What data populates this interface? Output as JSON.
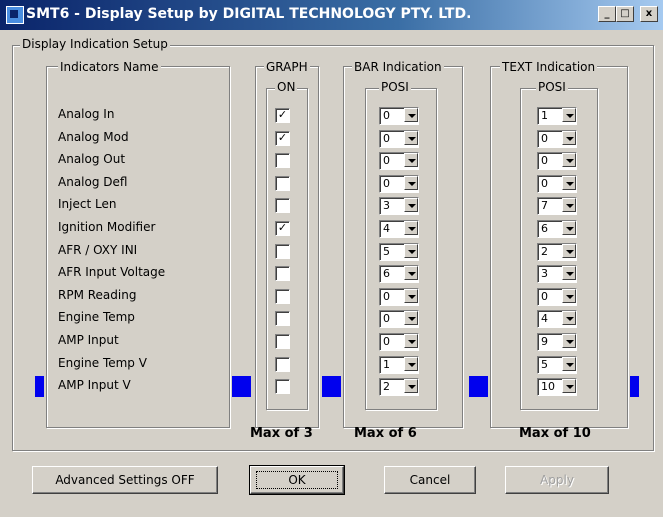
{
  "window": {
    "title": "SMT6 - Display Setup   by DIGITAL TECHNOLOGY PTY. LTD.",
    "minimize": "_",
    "maximize": "□",
    "close": "x"
  },
  "main": {
    "group_label": "Display Indication Setup"
  },
  "indicators": {
    "header": "Indicators Name",
    "items": [
      "Analog In",
      "Analog Mod",
      "Analog Out",
      "Analog Defl",
      "Inject Len",
      "Ignition Modifier",
      "AFR / OXY INI",
      "AFR Input Voltage",
      "RPM Reading",
      "Engine Temp",
      "AMP Input",
      "Engine Temp V",
      "AMP Input V"
    ]
  },
  "graph": {
    "header": "GRAPH",
    "sub": "ON",
    "checked": [
      true,
      true,
      false,
      false,
      false,
      true,
      false,
      false,
      false,
      false,
      false,
      false,
      false
    ],
    "max_label": "Max of 3"
  },
  "bar": {
    "header": "BAR Indication",
    "sub": "POSI",
    "values": [
      "0",
      "0",
      "0",
      "0",
      "3",
      "4",
      "5",
      "6",
      "0",
      "0",
      "0",
      "1",
      "2"
    ],
    "max_label": "Max of 6"
  },
  "text": {
    "header": "TEXT Indication",
    "sub": "POSI",
    "values": [
      "1",
      "0",
      "0",
      "0",
      "7",
      "6",
      "2",
      "3",
      "0",
      "4",
      "9",
      "5",
      "10"
    ],
    "max_label": "Max of 10"
  },
  "buttons": {
    "advanced": "Advanced Settings OFF",
    "ok": "OK",
    "cancel": "Cancel",
    "apply": "Apply"
  },
  "colors": {
    "indicator_blue": "#0000ee"
  }
}
